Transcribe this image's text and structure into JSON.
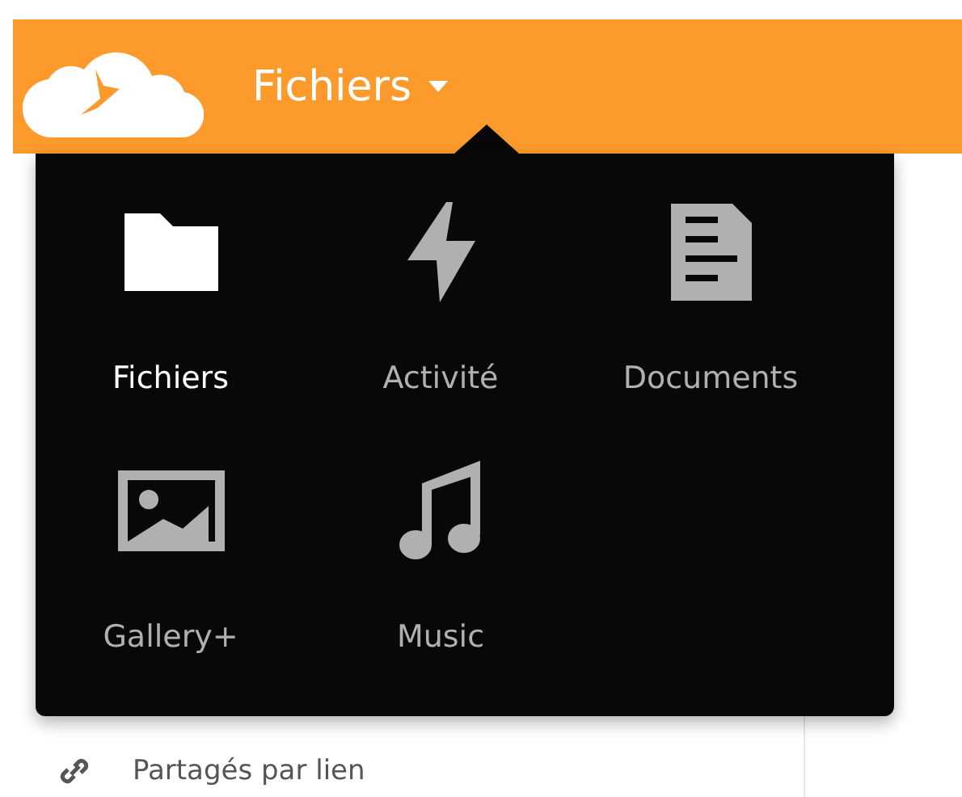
{
  "header": {
    "title": "Fichiers"
  },
  "app_menu": {
    "items": [
      {
        "label": "Fichiers",
        "kind": "folder",
        "selected": true
      },
      {
        "label": "Activité",
        "kind": "activity",
        "selected": false
      },
      {
        "label": "Documents",
        "kind": "document",
        "selected": false
      },
      {
        "label": "Gallery+",
        "kind": "gallery",
        "selected": false
      },
      {
        "label": "Music",
        "kind": "music",
        "selected": false
      }
    ]
  },
  "sidebar": {
    "items": [
      {
        "label": "Partagés par lien",
        "kind": "link"
      }
    ]
  }
}
